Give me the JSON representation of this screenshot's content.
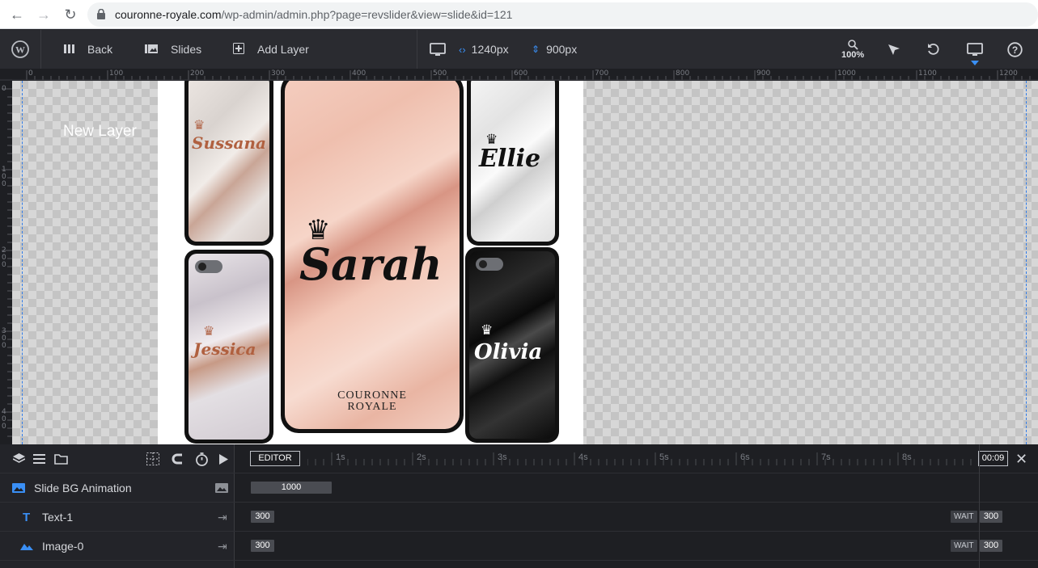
{
  "browser": {
    "url_domain": "couronne-royale.com",
    "url_path": "/wp-admin/admin.php?page=revslider&view=slide&id=121"
  },
  "toolbar": {
    "back_label": "Back",
    "slides_label": "Slides",
    "add_layer_label": "Add Layer",
    "width_value": "1240px",
    "height_value": "900px",
    "zoom_value": "100%"
  },
  "ruler": {
    "top_ticks": [
      "0",
      "100",
      "200",
      "300",
      "400",
      "500",
      "600",
      "700",
      "800",
      "900",
      "1000",
      "1100",
      "1200"
    ],
    "left_ticks": [
      "0",
      "100",
      "200",
      "300",
      "400"
    ]
  },
  "canvas": {
    "new_layer_text": "New Layer",
    "phones": {
      "sussana": "Sussana",
      "sarah": "Sarah",
      "ellie": "Ellie",
      "jessica": "Jessica",
      "olivia": "Olivia",
      "brand_line1": "COURONNE",
      "brand_line2": "ROYALE"
    }
  },
  "timeline": {
    "editor_label": "EDITOR",
    "time_value": "00:09",
    "seconds": [
      "1s",
      "2s",
      "3s",
      "4s",
      "5s",
      "6s",
      "7s",
      "8s"
    ],
    "rows": [
      {
        "label": "Slide BG Animation",
        "chip": "1000"
      },
      {
        "label": "Text-1",
        "chip": "300",
        "wait_label": "WAIT",
        "wait_value": "300"
      },
      {
        "label": "Image-0",
        "chip": "300",
        "wait_label": "WAIT",
        "wait_value": "300"
      }
    ]
  },
  "colors": {
    "accent": "#3a8ff5",
    "toolbar_bg": "#2a2b30",
    "timeline_bg": "#1e1f23"
  }
}
